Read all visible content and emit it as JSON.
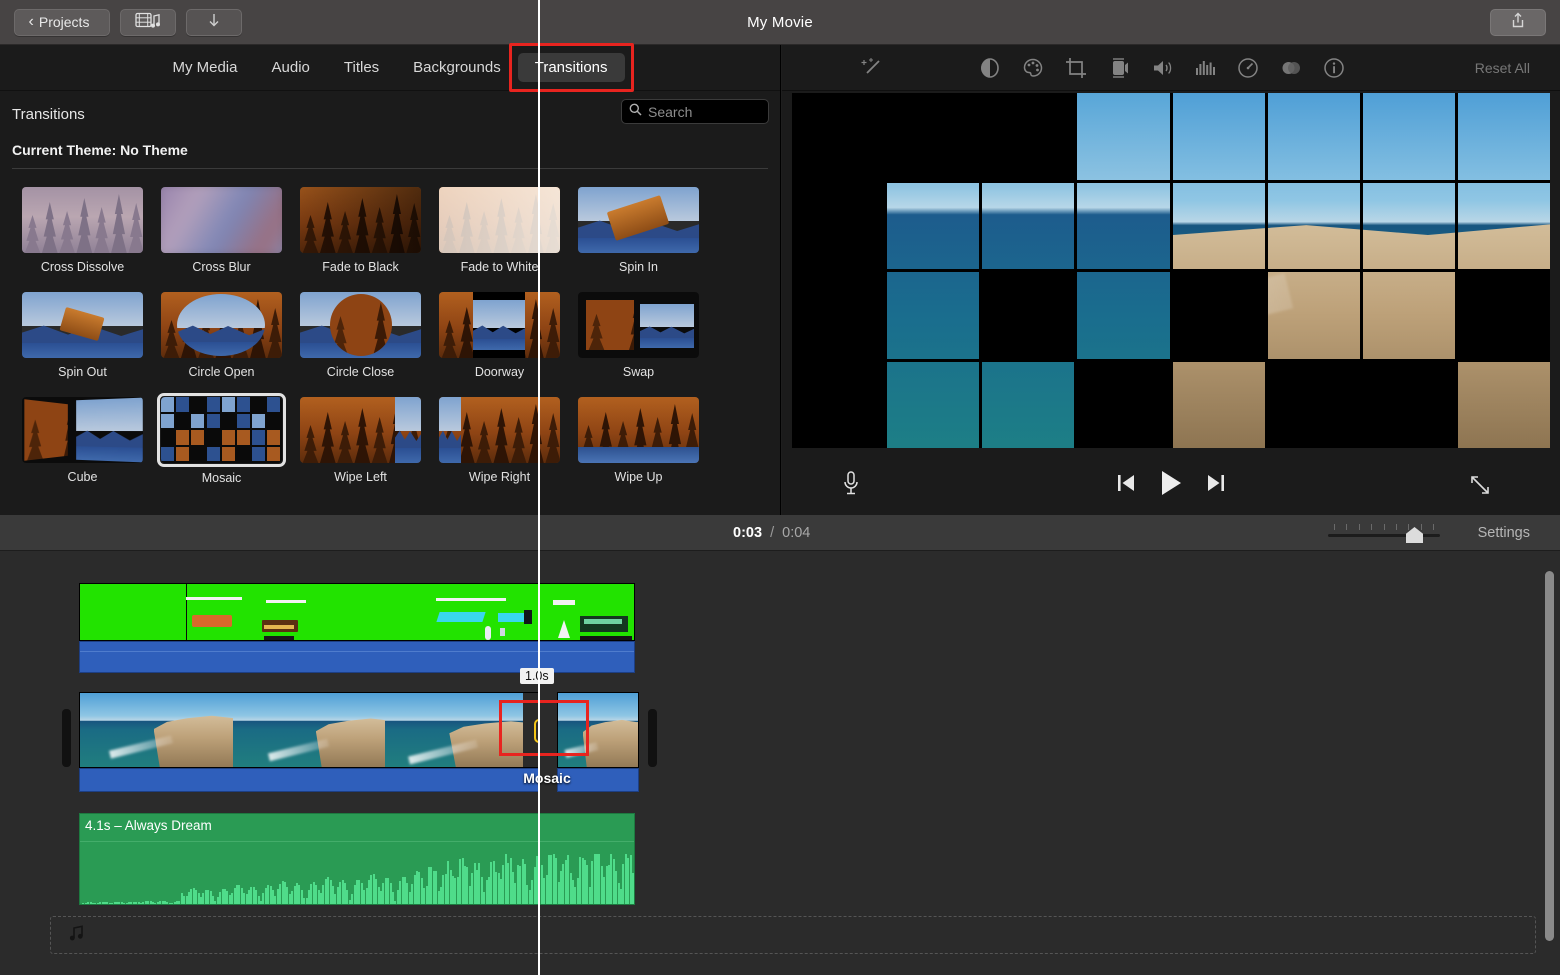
{
  "titlebar": {
    "back_label": "Projects",
    "back_chevron": "chevron-left-icon",
    "media_icon": "film-music-icon",
    "download_icon": "download-arrow-icon",
    "title": "My Movie",
    "share_icon": "share-icon"
  },
  "browser": {
    "tabs": [
      {
        "label": "My Media",
        "active": false
      },
      {
        "label": "Audio",
        "active": false
      },
      {
        "label": "Titles",
        "active": false
      },
      {
        "label": "Backgrounds",
        "active": false
      },
      {
        "label": "Transitions",
        "active": true,
        "annotated": true
      }
    ],
    "panel_title": "Transitions",
    "search_placeholder": "Search",
    "search_value": "",
    "current_theme": "Current Theme: No Theme",
    "transitions": [
      {
        "label": "Cross Dissolve",
        "style": "dissolve",
        "selected": false
      },
      {
        "label": "Cross Blur",
        "style": "blur",
        "selected": false
      },
      {
        "label": "Fade to Black",
        "style": "fade-black",
        "selected": false
      },
      {
        "label": "Fade to White",
        "style": "fade-white",
        "selected": false
      },
      {
        "label": "Spin In",
        "style": "spin-in",
        "selected": false
      },
      {
        "label": "Spin Out",
        "style": "spin-out",
        "selected": false
      },
      {
        "label": "Circle Open",
        "style": "circle-open",
        "selected": false
      },
      {
        "label": "Circle Close",
        "style": "circle-close",
        "selected": false
      },
      {
        "label": "Doorway",
        "style": "doorway",
        "selected": false
      },
      {
        "label": "Swap",
        "style": "swap",
        "selected": false
      },
      {
        "label": "Cube",
        "style": "cube",
        "selected": false
      },
      {
        "label": "Mosaic",
        "style": "mosaic",
        "selected": true
      },
      {
        "label": "Wipe Left",
        "style": "wipe-left",
        "selected": false
      },
      {
        "label": "Wipe Right",
        "style": "wipe-right",
        "selected": false
      },
      {
        "label": "Wipe Up",
        "style": "wipe-up",
        "selected": false
      }
    ]
  },
  "viewer": {
    "toolbar_icons": [
      "magic-wand-icon",
      "color-balance-icon",
      "color-correction-palette-icon",
      "crop-icon",
      "stabilization-camera-icon",
      "volume-icon",
      "equalizer-icon",
      "speed-gauge-icon",
      "filters-icon",
      "info-icon"
    ],
    "reset_all_label": "Reset All",
    "preview_effect": "mosaic",
    "controls": {
      "record_voiceover_icon": "microphone-icon",
      "previous_icon": "skip-previous-icon",
      "play_icon": "play-icon",
      "next_icon": "skip-next-icon",
      "fullscreen_icon": "fullscreen-icon"
    }
  },
  "timeline_bar": {
    "current_time": "0:03",
    "separator": "/",
    "total_time": "0:04",
    "settings_label": "Settings",
    "zoom_value": 70
  },
  "timeline": {
    "transition": {
      "duration_badge": "1.0s",
      "name": "Mosaic",
      "icon": "transition-bowtie-icon",
      "selected": true,
      "annotated": true
    },
    "music_clip": {
      "label": "4.1s – Always Dream"
    },
    "dropzone_icon": "music-note-icon"
  },
  "colors": {
    "accent_selection": "#f4c518",
    "annotation_red": "#e8241f",
    "green_screen_clip": "#22e300",
    "audio_bar_blue": "#2f5fbb",
    "music_clip_green": "#2a9b54",
    "titlebar": "#474444",
    "panel_bg": "#1b1b1b"
  }
}
